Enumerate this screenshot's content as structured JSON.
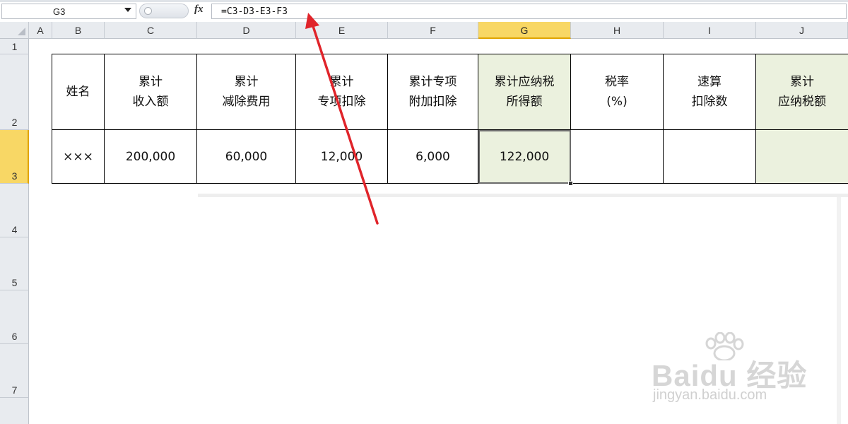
{
  "formula_bar": {
    "name_box": "G3",
    "fx_label": "fx",
    "formula": "=C3-D3-E3-F3"
  },
  "columns": [
    "A",
    "B",
    "C",
    "D",
    "E",
    "F",
    "G",
    "H",
    "I",
    "J"
  ],
  "selected_column": "G",
  "rows": [
    "1",
    "2",
    "3",
    "4",
    "5",
    "6",
    "7"
  ],
  "selected_row": "3",
  "table": {
    "headers": [
      "姓名",
      "累计\n收入额",
      "累计\n减除费用",
      "累计\n专项扣除",
      "累计专项\n附加扣除",
      "累计应纳税\n所得额",
      "税率\n(%)",
      "速算\n扣除数",
      "累计\n应纳税额"
    ],
    "row": [
      "×××",
      "200,000",
      "60,000",
      "12,000",
      "6,000",
      "122,000",
      "",
      "",
      ""
    ]
  },
  "watermark": {
    "brand": "Baidu 经验",
    "site": "jingyan.baidu.com"
  },
  "colors": {
    "highlight_green": "#ebf1de",
    "selected_header": "#f8d765",
    "arrow": "#e0242a"
  }
}
